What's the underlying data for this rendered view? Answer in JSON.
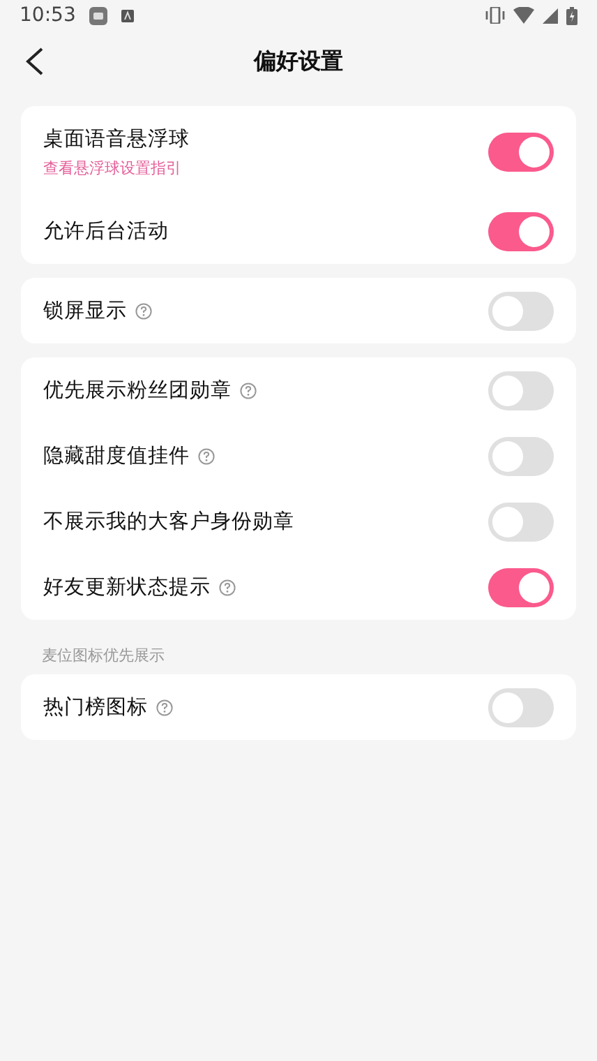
{
  "status_bar": {
    "time": "10:53"
  },
  "nav": {
    "title": "偏好设置"
  },
  "groups": [
    {
      "items": [
        {
          "label": "桌面语音悬浮球",
          "link": "查看悬浮球设置指引",
          "help": false,
          "on": true
        },
        {
          "label": "允许后台活动",
          "help": false,
          "on": true
        }
      ]
    },
    {
      "items": [
        {
          "label": "锁屏显示",
          "help": true,
          "on": false
        }
      ]
    },
    {
      "items": [
        {
          "label": "优先展示粉丝团勋章",
          "help": true,
          "on": false
        },
        {
          "label": "隐藏甜度值挂件",
          "help": true,
          "on": false
        },
        {
          "label": "不展示我的大客户身份勋章",
          "help": false,
          "on": false
        },
        {
          "label": "好友更新状态提示",
          "help": true,
          "on": true
        }
      ]
    },
    {
      "header": "麦位图标优先展示",
      "items": [
        {
          "label": "热门榜图标",
          "help": true,
          "on": false
        }
      ]
    }
  ]
}
